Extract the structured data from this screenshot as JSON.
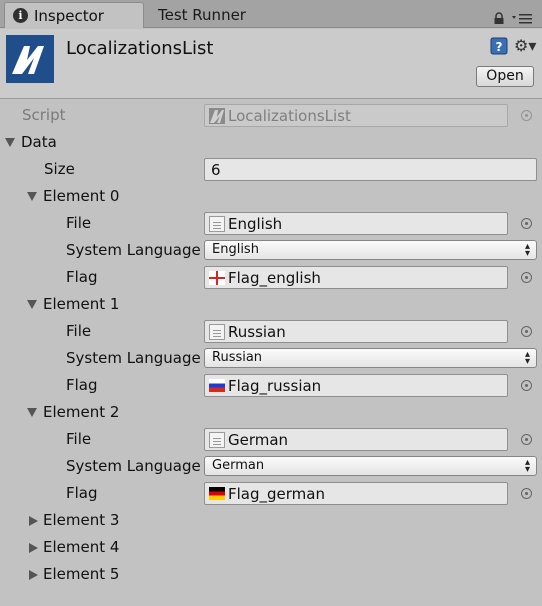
{
  "tabs": {
    "inspector": "Inspector",
    "test_runner": "Test Runner"
  },
  "header": {
    "title": "LocalizationsList",
    "open_label": "Open"
  },
  "script": {
    "label": "Script",
    "value": "LocalizationsList"
  },
  "data": {
    "label": "Data",
    "size_label": "Size",
    "size_value": "6",
    "elements": [
      {
        "label": "Element 0",
        "file_label": "File",
        "file_value": "English",
        "lang_label": "System Language",
        "lang_value": "English",
        "flag_label": "Flag",
        "flag_value": "Flag_english",
        "flag_icon": "england-flag-icon"
      },
      {
        "label": "Element 1",
        "file_label": "File",
        "file_value": "Russian",
        "lang_label": "System Language",
        "lang_value": "Russian",
        "flag_label": "Flag",
        "flag_value": "Flag_russian",
        "flag_icon": "russia-flag-icon"
      },
      {
        "label": "Element 2",
        "file_label": "File",
        "file_value": "German",
        "lang_label": "System Language",
        "lang_value": "German",
        "flag_label": "Flag",
        "flag_value": "Flag_german",
        "flag_icon": "germany-flag-icon"
      },
      {
        "label": "Element 3"
      },
      {
        "label": "Element 4"
      },
      {
        "label": "Element 5"
      }
    ]
  }
}
